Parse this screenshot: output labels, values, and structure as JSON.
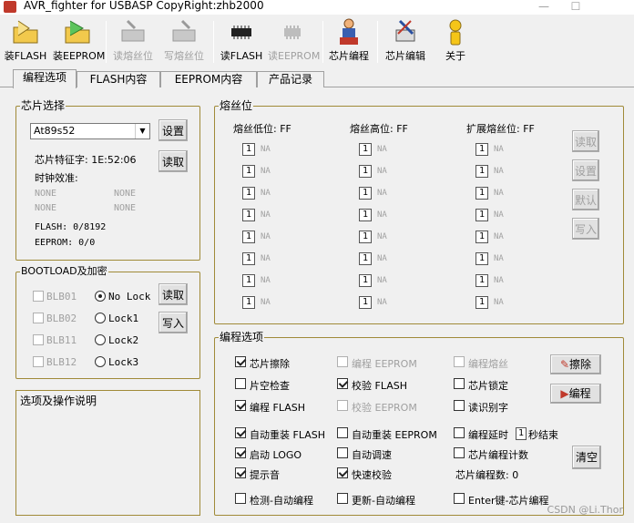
{
  "window": {
    "title": "AVR_fighter for USBASP CopyRight:zhb2000",
    "min": "—",
    "max": "☐"
  },
  "toolbar": [
    {
      "label": "装FLASH",
      "icon": "folder-load-icon",
      "enabled": true
    },
    {
      "label": "装EEPROM",
      "icon": "folder-load-green-icon",
      "enabled": true
    },
    {
      "label": "读熔丝位",
      "icon": "read-fuse-icon",
      "enabled": false
    },
    {
      "label": "写熔丝位",
      "icon": "write-fuse-icon",
      "enabled": false
    },
    {
      "label": "读FLASH",
      "icon": "chip-read-icon",
      "enabled": true
    },
    {
      "label": "读EEPROM",
      "icon": "chip-eeprom-icon",
      "enabled": false
    },
    {
      "label": "芯片编程",
      "icon": "programmer-person-icon",
      "enabled": true
    },
    {
      "label": "芯片编辑",
      "icon": "chip-edit-icon",
      "enabled": true
    },
    {
      "label": "关于",
      "icon": "about-icon",
      "enabled": true
    }
  ],
  "tabs": [
    "编程选项",
    "FLASH内容",
    "EEPROM内容",
    "产品记录"
  ],
  "chip": {
    "group_title": "芯片选择",
    "selected": "At89s52",
    "signature_label": "芯片特征字: 1E:52:06",
    "clock_label": "时钟效准:",
    "clock_values": [
      "NONE",
      "NONE",
      "NONE",
      "NONE"
    ],
    "flash_label": "FLASH: 0/8192",
    "eeprom_label": "EEPROM: 0/0",
    "set_button": "设置",
    "read_button": "读取"
  },
  "bootload": {
    "group_title": "BOOTLOAD及加密",
    "checks": [
      "BLB01",
      "BLB02",
      "BLB11",
      "BLB12"
    ],
    "radios": [
      "No Lock",
      "Lock1",
      "Lock2",
      "Lock3"
    ],
    "selected_radio": 0,
    "read_button": "读取",
    "write_button": "写入"
  },
  "description": {
    "title": "选项及操作说明"
  },
  "fuse": {
    "group_title": "熔丝位",
    "columns": [
      {
        "header": "熔丝低位: FF"
      },
      {
        "header": "熔丝高位: FF"
      },
      {
        "header": "扩展熔丝位: FF"
      }
    ],
    "bit_value": "1",
    "bit_label": "NA",
    "buttons": [
      "读取",
      "设置",
      "默认",
      "写入"
    ]
  },
  "options": {
    "group_title": "编程选项",
    "rows1": [
      [
        {
          "label": "芯片擦除",
          "on": true,
          "enabled": true
        },
        {
          "label": "编程 EEPROM",
          "on": false,
          "enabled": false
        },
        {
          "label": "编程熔丝",
          "on": false,
          "enabled": false
        }
      ],
      [
        {
          "label": "片空检查",
          "on": false,
          "enabled": true
        },
        {
          "label": "校验 FLASH",
          "on": true,
          "enabled": true
        },
        {
          "label": "芯片锁定",
          "on": false,
          "enabled": true
        }
      ],
      [
        {
          "label": "编程 FLASH",
          "on": true,
          "enabled": true
        },
        {
          "label": "校验 EEPROM",
          "on": false,
          "enabled": false
        },
        {
          "label": "读识别字",
          "on": false,
          "enabled": true
        }
      ]
    ],
    "rows2": [
      [
        {
          "label": "自动重装 FLASH",
          "on": true
        },
        {
          "label": "自动重装 EEPROM",
          "on": false
        }
      ],
      [
        {
          "label": "启动 LOGO",
          "on": true
        },
        {
          "label": "自动调速",
          "on": false
        }
      ],
      [
        {
          "label": "提示音",
          "on": true
        },
        {
          "label": "快速校验",
          "on": true
        }
      ]
    ],
    "delay_label": "编程延时",
    "delay_value": "1",
    "delay_suffix": "秒结束",
    "count_check_label": "芯片编程计数",
    "count_label": "芯片编程数: 0",
    "bottom_checks": [
      "检测-自动编程",
      "更新-自动编程",
      "Enter键-芯片编程"
    ],
    "erase_button": "擦除",
    "program_button": "编程",
    "clear_button": "清空"
  },
  "watermark": "CSDN @Li.Thor",
  "colors": {
    "group_border": "#a08a38",
    "background": "#f0f0f0"
  }
}
